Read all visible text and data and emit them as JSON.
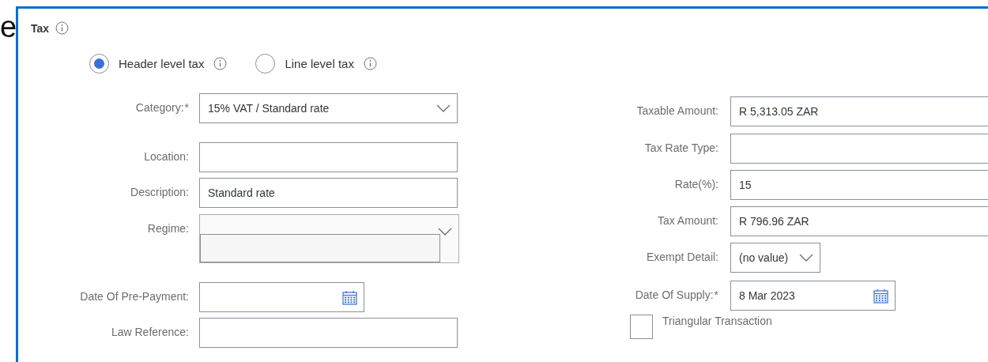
{
  "side_text": "e",
  "section": {
    "title": "Tax",
    "info": true
  },
  "tax_level": [
    {
      "label": "Header level tax",
      "selected": true,
      "info": true
    },
    {
      "label": "Line level tax",
      "selected": false,
      "info": true
    }
  ],
  "left_fields": [
    {
      "kind": "select",
      "label": "Category:",
      "required_mark": "*",
      "value": "15% VAT / Standard rate"
    },
    {
      "kind": "input",
      "label": "Location:"
    },
    {
      "kind": "input",
      "label": "Description:",
      "value": "Standard rate"
    },
    {
      "kind": "combo",
      "label": "Regime:"
    },
    {
      "kind": "date",
      "label": "Date Of Pre-Payment:"
    },
    {
      "kind": "input",
      "label": "Law Reference:"
    }
  ],
  "right_fields": [
    {
      "kind": "input",
      "label": "Taxable Amount:",
      "value": "R 5,313.05 ZAR"
    },
    {
      "kind": "input",
      "label": "Tax Rate Type:"
    },
    {
      "kind": "input",
      "label": "Rate(%):",
      "value": "15"
    },
    {
      "kind": "input",
      "label": "Tax Amount:",
      "value": "R 796.96 ZAR"
    },
    {
      "kind": "select",
      "label": "Exempt Detail:",
      "value": "(no value)"
    },
    {
      "kind": "date",
      "label": "Date Of Supply:",
      "required_mark": "*",
      "value": "8 Mar 2023"
    }
  ],
  "triangular_transaction": {
    "label": "Triangular Transaction",
    "checked": false
  }
}
